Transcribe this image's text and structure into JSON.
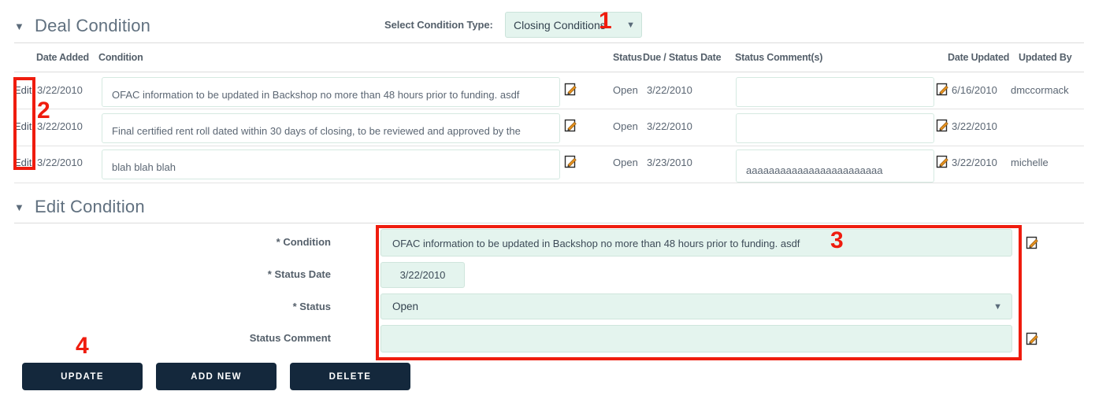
{
  "sections": {
    "deal_condition": {
      "title": "Deal Condition",
      "caret": "▼"
    },
    "edit_condition": {
      "title": "Edit Condition",
      "caret": "▼"
    }
  },
  "condition_type": {
    "label": "Select Condition Type:",
    "value": "Closing Conditions",
    "caret": "▼"
  },
  "table": {
    "headers": {
      "date_added": "Date Added",
      "condition": "Condition",
      "status": "Status",
      "due_status_date": "Due / Status Date",
      "status_comments": "Status Comment(s)",
      "date_updated": "Date Updated",
      "updated_by": "Updated By"
    },
    "edit_label": "Edit",
    "rows": [
      {
        "edit": "Edit",
        "date_added": "3/22/2010",
        "condition": "OFAC information to be updated in Backshop no more than 48 hours prior to funding. asdf",
        "status": "Open",
        "due_status_date": "3/22/2010",
        "status_comment": "",
        "date_updated": "6/16/2010",
        "updated_by": "dmccormack"
      },
      {
        "edit": "Edit",
        "date_added": "3/22/2010",
        "condition": "Final certified rent roll dated within 30 days of closing, to be reviewed and approved by the",
        "status": "Open",
        "due_status_date": "3/22/2010",
        "status_comment": "",
        "date_updated": "3/22/2010",
        "updated_by": ""
      },
      {
        "edit": "Edit",
        "date_added": "3/22/2010",
        "condition": "blah blah blah",
        "status": "Open",
        "due_status_date": "3/23/2010",
        "status_comment": "aaaaaaaaaaaaaaaaaaaaaaaa",
        "date_updated": "3/22/2010",
        "updated_by": "michelle"
      }
    ]
  },
  "edit_form": {
    "condition": {
      "label": "* Condition",
      "value": "OFAC information to be updated in Backshop no more than 48 hours prior to funding. asdf"
    },
    "status_date": {
      "label": "* Status Date",
      "value": "3/22/2010"
    },
    "status": {
      "label": "* Status",
      "value": "Open",
      "caret": "▼"
    },
    "status_comment": {
      "label": "Status Comment",
      "value": ""
    }
  },
  "buttons": {
    "update": "Update",
    "add_new": "Add New",
    "delete": "Delete"
  },
  "annotations": [
    {
      "number": "1"
    },
    {
      "number": "2"
    },
    {
      "number": "3"
    },
    {
      "number": "4"
    }
  ],
  "colors": {
    "accent_field": "#e4f4ee",
    "button": "#14283c",
    "annotation": "#ef1c0e",
    "heading": "#60707f"
  }
}
